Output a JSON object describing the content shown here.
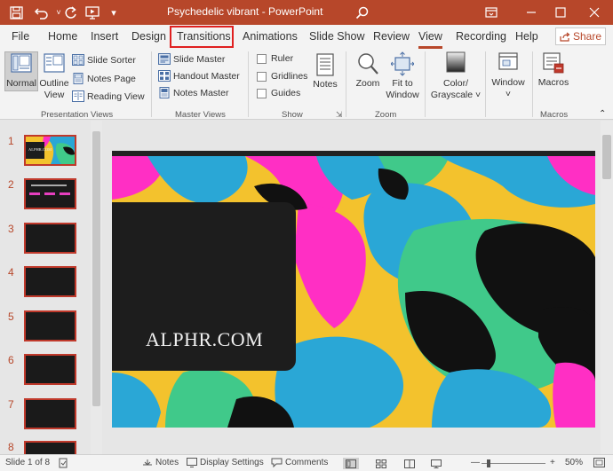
{
  "app": {
    "title": "Psychedelic vibrant  -  PowerPoint",
    "accent": "#b7472a",
    "highlight_box_color": "#e02020"
  },
  "quick_access": [
    "save-icon",
    "undo-icon",
    "redo-icon",
    "present-from-beginning-icon",
    "customize-icon"
  ],
  "window_controls": [
    "ribbon-display-icon",
    "minimize-icon",
    "restore-icon",
    "close-icon"
  ],
  "tabs": [
    "File",
    "Home",
    "Insert",
    "Design",
    "Transitions",
    "Animations",
    "Slide Show",
    "Review",
    "View",
    "Recording",
    "Help"
  ],
  "active_tab": "View",
  "highlighted_tab": "Transitions",
  "share_label": "Share",
  "ribbon": {
    "presentation_views": {
      "label": "Presentation Views",
      "normal": "Normal",
      "outline_line1": "Outline",
      "outline_line2": "View",
      "slide_sorter": "Slide Sorter",
      "notes_page": "Notes Page",
      "reading_view": "Reading View"
    },
    "master_views": {
      "label": "Master Views",
      "slide_master": "Slide Master",
      "handout_master": "Handout Master",
      "notes_master": "Notes Master"
    },
    "show": {
      "label": "Show",
      "ruler": "Ruler",
      "gridlines": "Gridlines",
      "guides": "Guides",
      "notes": "Notes"
    },
    "zoom": {
      "label": "Zoom",
      "zoom": "Zoom",
      "fit_line1": "Fit to",
      "fit_line2": "Window"
    },
    "color": {
      "line1": "Color/",
      "line2": "Grayscale ˅"
    },
    "window": {
      "label": "Window",
      "caret": "˅"
    },
    "macros": {
      "label": "Macros",
      "button": "Macros"
    }
  },
  "thumbnails": [
    {
      "num": "1",
      "caption": "ALPHR.COM"
    },
    {
      "num": "2",
      "caption": ""
    },
    {
      "num": "3",
      "caption": ""
    },
    {
      "num": "4",
      "caption": ""
    },
    {
      "num": "5",
      "caption": ""
    },
    {
      "num": "6",
      "caption": ""
    },
    {
      "num": "7",
      "caption": ""
    },
    {
      "num": "8",
      "caption": ""
    }
  ],
  "slide": {
    "title_text": "ALPHR.COM",
    "colors": [
      "#f3c22d",
      "#2aa7d6",
      "#ff2fc4",
      "#40c98a",
      "#111111"
    ]
  },
  "status": {
    "slide_of": "Slide 1 of 8",
    "notes": "Notes",
    "display_settings": "Display Settings",
    "comments": "Comments",
    "zoom_level": "50%",
    "zoom_minus": "—",
    "zoom_plus": "+"
  }
}
